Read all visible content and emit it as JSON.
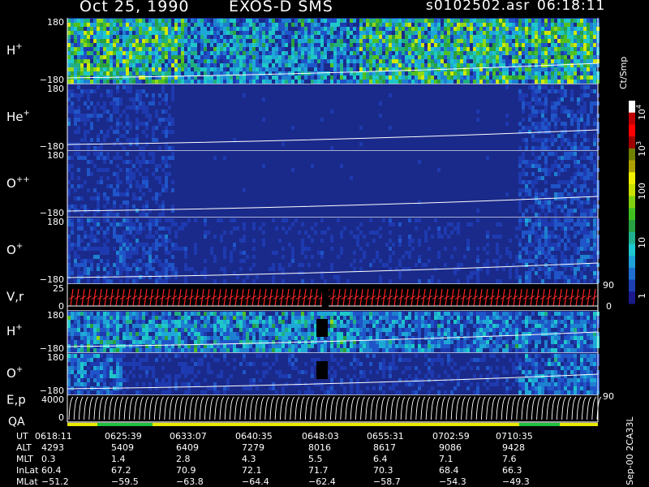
{
  "header": {
    "date": "Oct 25, 1990",
    "instrument": "EXOS-D SMS",
    "file": "s0102502.asr",
    "time": "06:18:11"
  },
  "chart_data": {
    "type": "heatmap",
    "panels": [
      {
        "id": "h_plus",
        "label": "H",
        "sup": "+",
        "ytop": "180",
        "ybot": "−180",
        "ylim": [
          -180,
          180
        ],
        "intensity": 0.55,
        "patches": 0.6
      },
      {
        "id": "he_plus",
        "label": "He",
        "sup": "+",
        "ytop": "180",
        "ybot": "−180",
        "ylim": [
          -180,
          180
        ],
        "intensity": 0.12,
        "patches": 0.2
      },
      {
        "id": "o_plus_plus",
        "label": "O",
        "sup": "++",
        "ytop": "180",
        "ybot": "−180",
        "ylim": [
          -180,
          180
        ],
        "intensity": 0.12,
        "patches": 0.2
      },
      {
        "id": "o_plus",
        "label": "O",
        "sup": "+",
        "ytop": "180",
        "ybot": "−180",
        "ylim": [
          -180,
          180
        ],
        "intensity": 0.18,
        "patches": 0.3
      },
      {
        "id": "v_r",
        "label": "V,r",
        "sup": "",
        "ytop": "25",
        "ybot": "0",
        "ylim": [
          0,
          25
        ],
        "right_top": "90",
        "right_bot": "0",
        "kind": "lines"
      },
      {
        "id": "h_plus_2",
        "label": "H",
        "sup": "+",
        "ytop": "180",
        "ybot": "−180",
        "ylim": [
          -180,
          180
        ],
        "intensity": 0.35,
        "patches": 0.5
      },
      {
        "id": "o_plus_2",
        "label": "O",
        "sup": "+",
        "ytop": "180",
        "ybot": "−180",
        "ylim": [
          -180,
          180
        ],
        "intensity": 0.22,
        "patches": 0.3
      },
      {
        "id": "e_p",
        "label": "E,p",
        "sup": "",
        "ytop": "4000",
        "ybot": "0",
        "ylim": [
          0,
          4000
        ],
        "right_top": "90",
        "kind": "curves"
      }
    ],
    "qa_label": "QA",
    "colorbar": {
      "unit": "Ct/Smp",
      "labels": [
        {
          "text": "10",
          "sup": "4",
          "value": 10000
        },
        {
          "text": "10",
          "sup": "3",
          "value": 1000
        },
        {
          "text": "100",
          "sup": "",
          "value": 100
        },
        {
          "text": "10",
          "sup": "",
          "value": 10
        },
        {
          "text": "1",
          "sup": "",
          "value": 1
        }
      ],
      "colors": [
        "#1a1a8c",
        "#1e3fb0",
        "#1f6fd0",
        "#1ea0d8",
        "#1ec8d0",
        "#20b090",
        "#28a040",
        "#40c020",
        "#80d010",
        "#c8e000",
        "#f0f000",
        "#b0a000",
        "#708000",
        "#a00000",
        "#ff0000",
        "#c00000",
        "#ffffff"
      ]
    },
    "footer_note": "Sep-00 2CA33L",
    "orbit_table": {
      "row_labels": [
        "UT",
        "ALT",
        "MLT",
        "InLat",
        "MLat"
      ],
      "columns": [
        [
          "0618:11",
          "4293",
          "0.3",
          "60.4",
          "−51.2"
        ],
        [
          "0625:39",
          "5409",
          "1.4",
          "67.2",
          "−59.5"
        ],
        [
          "0633:07",
          "6409",
          "2.8",
          "70.9",
          "−63.8"
        ],
        [
          "0640:35",
          "7279",
          "4.3",
          "72.1",
          "−64.4"
        ],
        [
          "0648:03",
          "8016",
          "5.5",
          "71.7",
          "−62.4"
        ],
        [
          "0655:31",
          "8617",
          "6.4",
          "70.3",
          "−58.7"
        ],
        [
          "0702:59",
          "9086",
          "7.1",
          "68.4",
          "−54.3"
        ],
        [
          "0710:35",
          "9428",
          "7.6",
          "66.3",
          "−49.3"
        ]
      ]
    }
  }
}
